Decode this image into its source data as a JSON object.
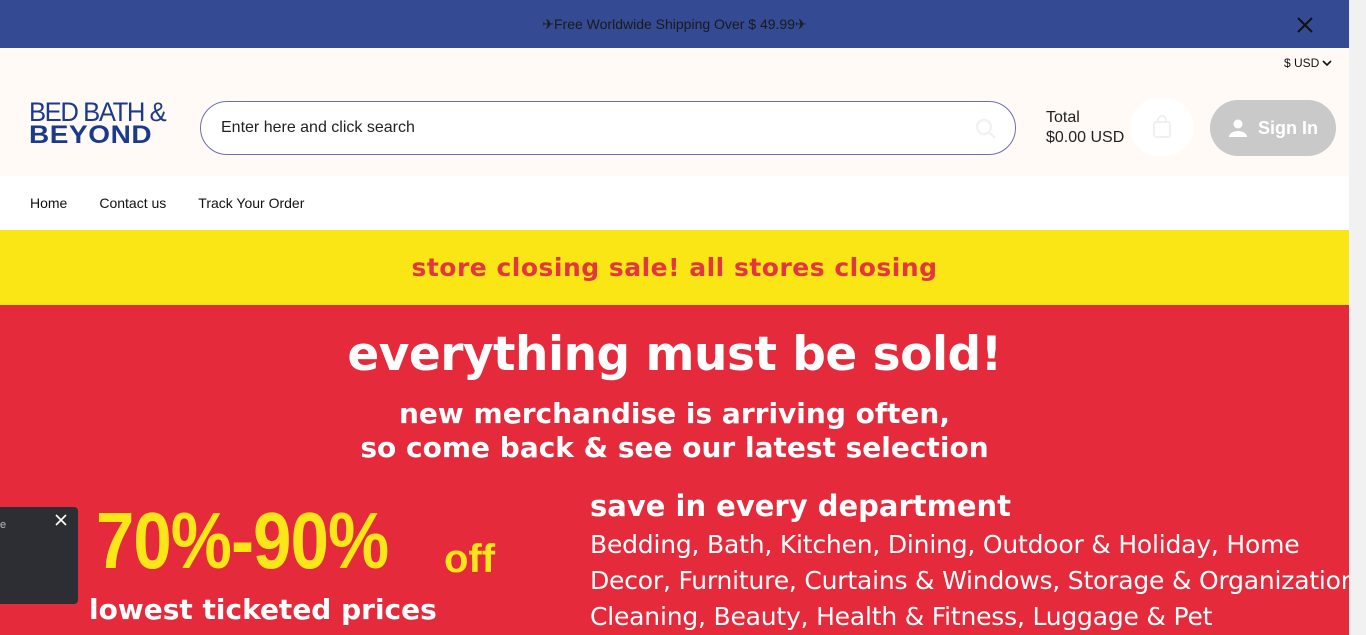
{
  "announcement": {
    "text": "✈Free Worldwide Shipping Over  $ 49.99✈",
    "close_icon": "close-icon"
  },
  "header": {
    "currency": "$ USD",
    "logo": {
      "line1": "BED BATH &",
      "line2": "BEYOND"
    },
    "search": {
      "placeholder": "Enter here and click search",
      "icon": "search-icon"
    },
    "cart": {
      "total_label": "Total",
      "total_value": "$0.00 USD",
      "icon": "bag-icon"
    },
    "signin": {
      "label": "Sign In",
      "icon": "user-icon"
    }
  },
  "nav": {
    "items": [
      "Home",
      "Contact us",
      "Track Your Order"
    ]
  },
  "banner": {
    "top_strip": "store closing sale! all stores closing",
    "headline": "everything must be sold!",
    "sub1": "new merchandise is arriving often,",
    "sub2": "so come back & see our latest selection",
    "discount": "70%-90%",
    "discount_suffix": "off",
    "discount_note": "lowest ticketed prices",
    "departments_heading": "save in every department",
    "departments_line1": "Bedding, Bath, Kitchen, Dining, Outdoor & Holiday, Home",
    "departments_line2": "Decor, Furniture, Curtains & Windows, Storage & Organization,",
    "departments_line3": "Cleaning, Beauty, Health & Fitness, Luggage & Pet"
  },
  "popup": {
    "text": "e"
  },
  "colors": {
    "announce_bg": "#344a93",
    "brand_blue": "#1b3a8a",
    "banner_yellow": "#fae615",
    "banner_red": "#e52a3b",
    "discount_yellow": "#fbe61a"
  }
}
